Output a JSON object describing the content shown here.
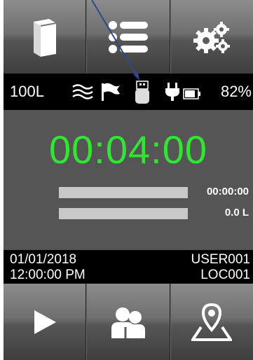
{
  "toolbar_top": {
    "buttons": [
      {
        "icon": "book-icon"
      },
      {
        "icon": "list-icon"
      },
      {
        "icon": "settings-gears-icon"
      }
    ]
  },
  "status": {
    "tank_volume": "100L",
    "icons": [
      "flow-waves-icon",
      "flag-icon",
      "usb-drive-icon",
      "power-plug-icon",
      "battery-icon"
    ],
    "battery_percent": "82%"
  },
  "main": {
    "timer": "00:04:00",
    "progress": [
      {
        "label": "00:00:00"
      },
      {
        "label": "0.0 L"
      }
    ]
  },
  "info": {
    "date": "01/01/2018",
    "time": "12:00:00 PM",
    "user": "USER001",
    "location": "LOC001"
  },
  "toolbar_bottom": {
    "buttons": [
      {
        "icon": "play-icon"
      },
      {
        "icon": "users-icon"
      },
      {
        "icon": "map-pin-icon"
      }
    ]
  },
  "colors": {
    "timer_green": "#33e533",
    "panel_gray": "#555555",
    "annotation_arrow": "#2c4a8c"
  }
}
